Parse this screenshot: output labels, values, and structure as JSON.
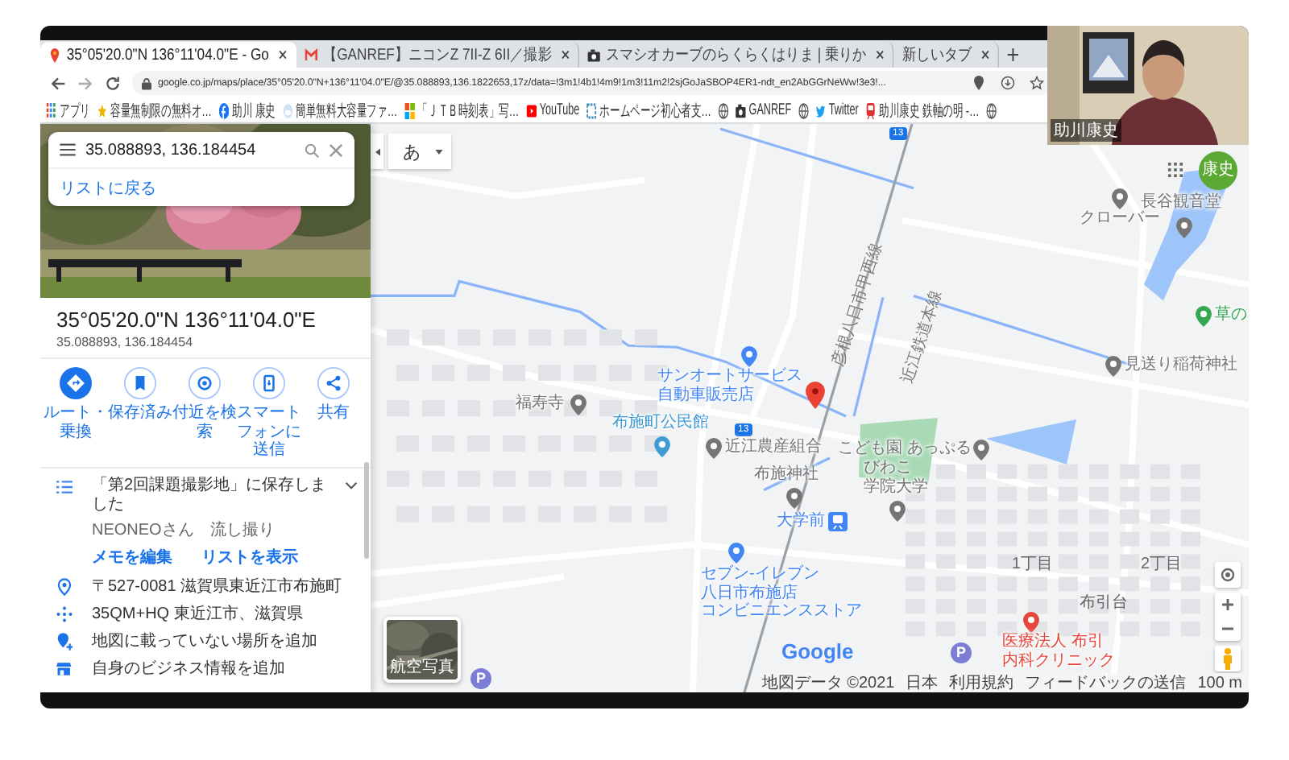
{
  "tabs": [
    {
      "title": "35°05'20.0\"N 136°11'04.0\"E - Go",
      "kind": "maps",
      "selected": true
    },
    {
      "title": "【GANREF】ニコンZ 7II-Z 6II／撮影",
      "kind": "mail",
      "selected": false
    },
    {
      "title": "スマシオカーブのらくらくはりま | 乗りか",
      "selected": false
    },
    {
      "title": "新しいタブ",
      "kind": "blank",
      "selected": false
    }
  ],
  "address": "google.co.jp/maps/place/35°05'20.0\"N+136°11'04.0\"E/@35.088893,136.1822653,17z/data=!3m1!4b1!4m9!1m3!11m2!2sjGoJaSBOP4ER1-ndt_en2AbGGrNeWw!3e3!...",
  "bookmarks": [
    {
      "label": "アプリ",
      "kind": "apps"
    },
    {
      "label": "容量無制限の無料オ…",
      "kind": "star"
    },
    {
      "label": "助川 康史",
      "kind": "social"
    },
    {
      "label": "簡単無料大容量ファ…",
      "kind": "cloud"
    },
    {
      "label": "「ＪＴＢ時刻表」写…",
      "kind": "tiles"
    },
    {
      "label": "YouTube",
      "kind": "video"
    },
    {
      "label": "ホームページ初心者支…",
      "kind": "site"
    },
    {
      "kind": "globe"
    },
    {
      "label": "GANREF"
    },
    {
      "kind": "globe"
    },
    {
      "label": "Twitter",
      "kind": "bird"
    },
    {
      "label": "助川康史 鉄軸の明 -…",
      "kind": "rail"
    },
    {
      "kind": "globe"
    }
  ],
  "sidebar": {
    "search": "35.088893, 136.184454",
    "back_link": "リストに戻る",
    "title": "35°05'20.0\"N 136°11'04.0\"E",
    "coords": "35.088893, 136.184454",
    "actions": [
      {
        "label": "ルート・乗換",
        "kind": "directions"
      },
      {
        "label": "保存済み",
        "kind": "save"
      },
      {
        "label": "付近を検索",
        "kind": "nearby"
      },
      {
        "label": "スマートフォンに送信",
        "kind": "phone"
      },
      {
        "label": "共有",
        "kind": "share"
      }
    ],
    "saved": {
      "text": "「第2回課題撮影地」に保存しました",
      "note": "NEONEOさん　流し撮り",
      "links": [
        "メモを編集",
        "リストを表示"
      ]
    },
    "info": [
      {
        "kind": "address",
        "text": "〒527-0081 滋賀県東近江市布施町"
      },
      {
        "kind": "pluscode",
        "text": "35QM+HQ 東近江市、滋賀県"
      },
      {
        "kind": "add-place",
        "text": "地図に載っていない場所を追加"
      },
      {
        "kind": "business",
        "text": "自身のビジネス情報を追加"
      }
    ]
  },
  "map": {
    "language_button": "あ",
    "account": "康史",
    "layer_label": "航空写真",
    "logo": "Google",
    "places": [
      {
        "lines": [
          "サンオートサービス"
        ],
        "sub": "自動車販売店",
        "kind": "pin",
        "color": "#4285f4"
      },
      {
        "lines": [
          "福寿寺"
        ],
        "kind": "pin",
        "color": "#757575"
      },
      {
        "lines": [
          "布施町公民館"
        ],
        "kind": "pin",
        "color": "#3f9ad6"
      },
      {
        "lines": [
          "近江農産組合"
        ],
        "kind": "pin",
        "color": "#757575"
      },
      {
        "lines": [
          "こども園 あっぷる"
        ],
        "kind": "pin",
        "color": "#757575"
      },
      {
        "lines": [
          "布施神社"
        ],
        "kind": "pin",
        "color": "#757575"
      },
      {
        "lines": [
          "びわこ",
          "学院大学"
        ],
        "kind": "pin",
        "color": "#757575"
      },
      {
        "lines": [
          "大学前"
        ],
        "kind": "station",
        "color": "#4285f4"
      },
      {
        "lines": [
          "セブン-イレブン",
          "八日市布施店"
        ],
        "sub": "コンビニエンスストア",
        "kind": "pin",
        "color": "#4285f4"
      },
      {
        "lines": [
          "クローバー"
        ],
        "kind": "pin",
        "color": "#757575"
      },
      {
        "lines": [
          "長谷観音堂"
        ],
        "kind": "pin",
        "color": "#757575"
      },
      {
        "lines": [
          "見送り稲荷神社"
        ],
        "kind": "pin",
        "color": "#757575"
      },
      {
        "lines": [
          "草の"
        ],
        "kind": "pin",
        "color": "#34a853"
      },
      {
        "lines": [
          "医療法人 布引",
          "内科クリニック"
        ],
        "kind": "pin",
        "color": "#e8453c"
      }
    ],
    "areas": [
      "1丁目",
      "2丁目",
      "布引台"
    ],
    "roads": [
      "彦根八日市甲西線",
      "近江鉄道本線"
    ],
    "route_shields": [
      "13",
      "13"
    ],
    "parking": [
      "P",
      "P"
    ],
    "footer": [
      "地図データ ©2021",
      "日本",
      "利用規約",
      "フィードバックの送信",
      "100 m"
    ]
  },
  "video": {
    "name": "助川康史"
  }
}
